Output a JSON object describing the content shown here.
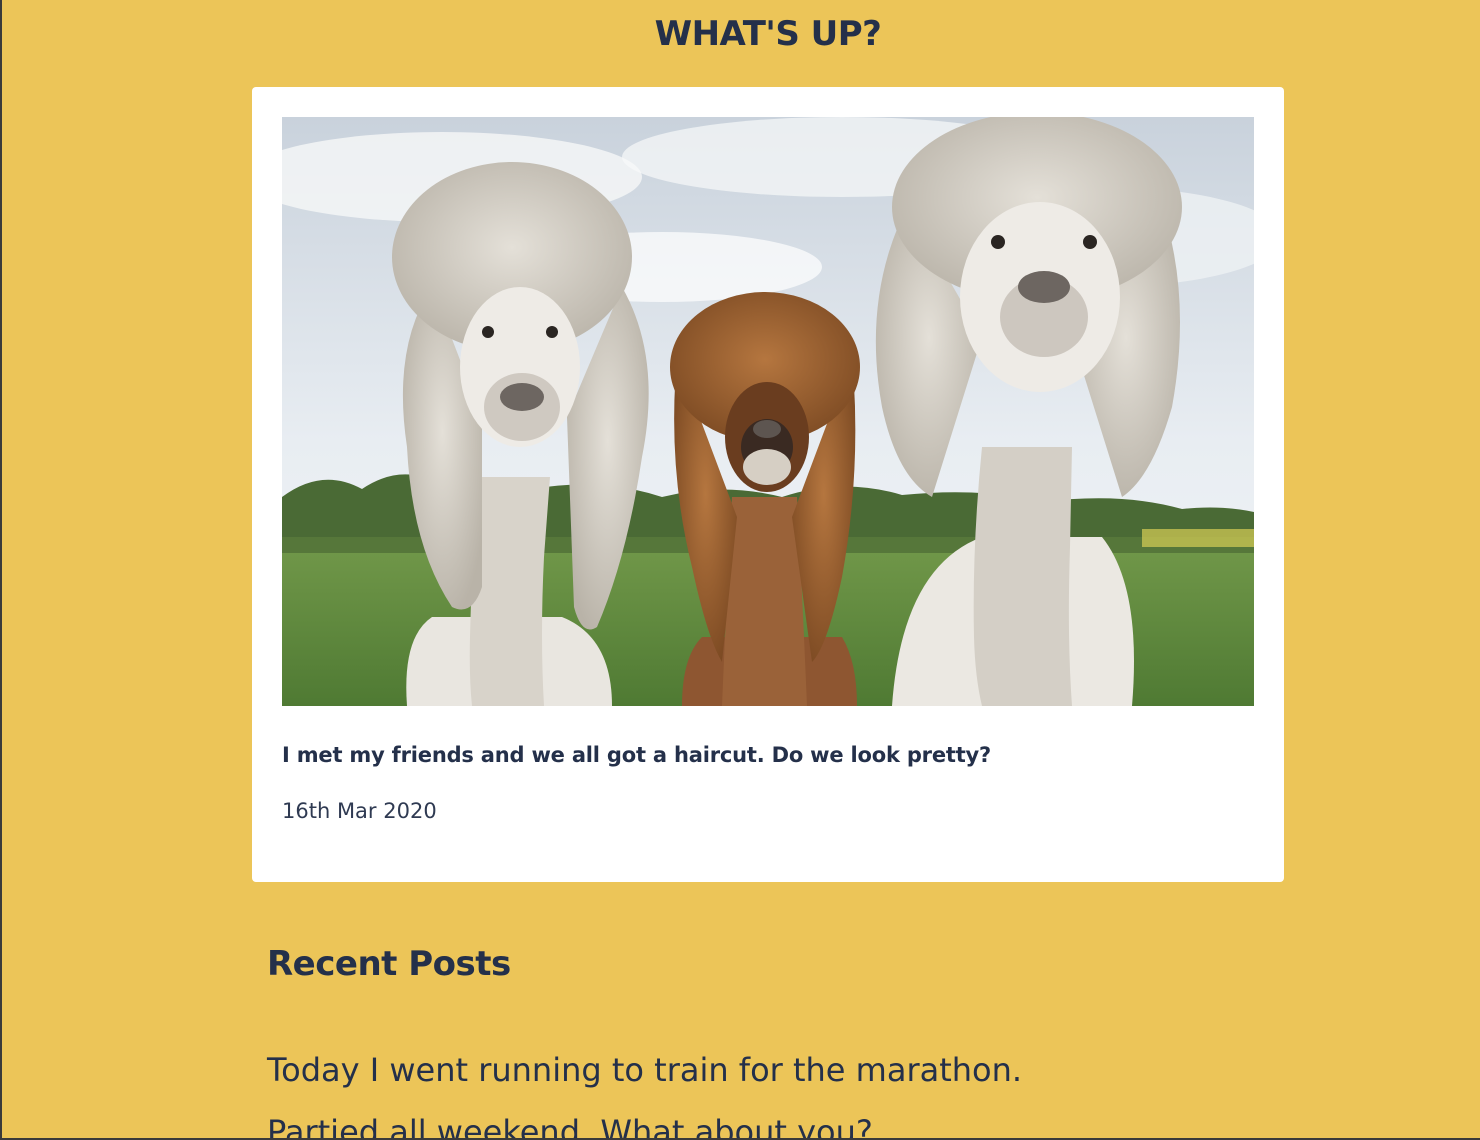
{
  "site": {
    "title": "WHAT'S UP?"
  },
  "featured_post": {
    "image_alt": "Three alpacas with haircuts",
    "caption": "I met my friends and we all got a haircut. Do we look pretty?",
    "date": "16th Mar 2020"
  },
  "recent": {
    "heading": "Recent Posts",
    "items": [
      {
        "label": "Today I went running to train for the marathon."
      },
      {
        "label": "Partied all weekend. What about you?"
      }
    ]
  },
  "colors": {
    "background": "#ecc558",
    "card": "#ffffff",
    "text": "#24304a"
  }
}
